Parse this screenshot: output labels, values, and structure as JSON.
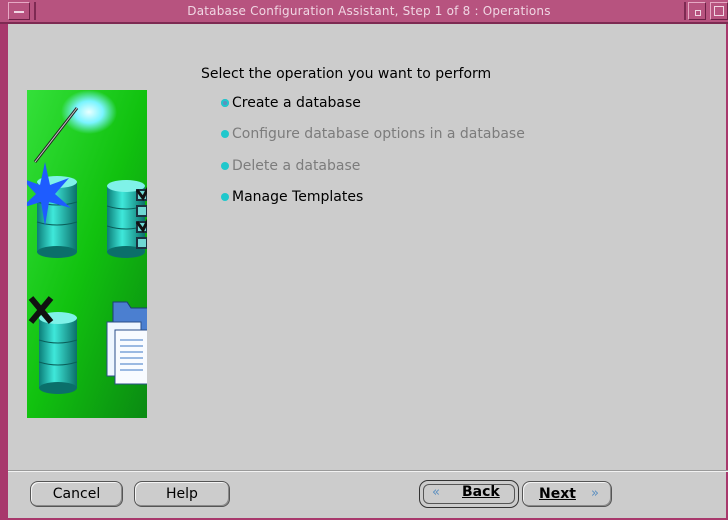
{
  "window": {
    "title": "Database Configuration Assistant, Step 1 of 8 : Operations"
  },
  "main": {
    "heading": "Select the operation you want to perform",
    "options": [
      {
        "label": "Create a database",
        "enabled": true,
        "selected": true
      },
      {
        "label": "Configure database options in a database",
        "enabled": false,
        "selected": false
      },
      {
        "label": "Delete a database",
        "enabled": false,
        "selected": false
      },
      {
        "label": "Manage Templates",
        "enabled": true,
        "selected": false
      }
    ]
  },
  "footer": {
    "cancel_label": "Cancel",
    "help_label": "Help",
    "back_label": "Back",
    "next_label": "Next",
    "back_arrow": "«",
    "next_arrow": "»"
  },
  "colors": {
    "titlebar": "#b7537f",
    "window_border": "#a8386c",
    "panel": "#cccccc",
    "radio": "#1fc8cc",
    "illustration_green": "#11c20f"
  }
}
